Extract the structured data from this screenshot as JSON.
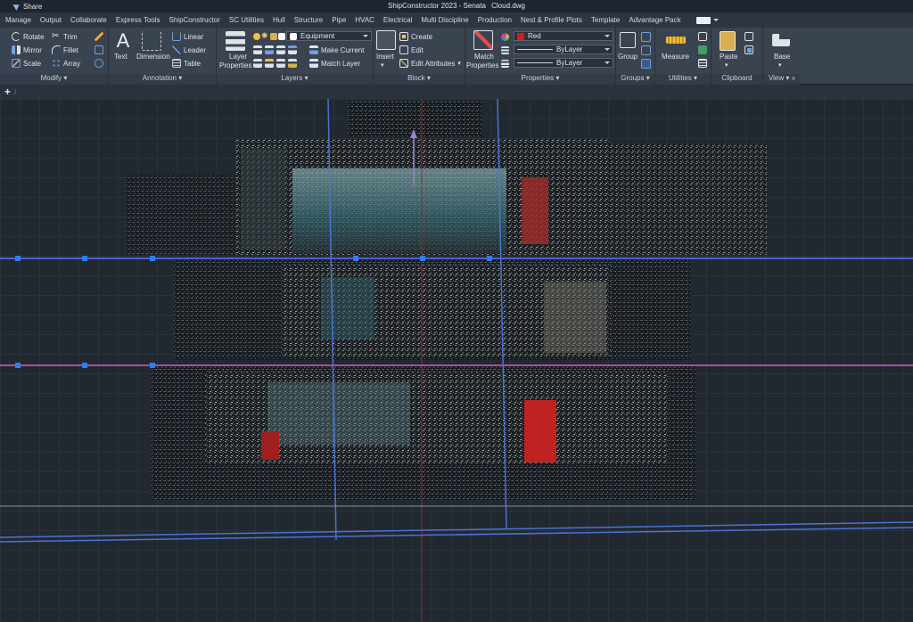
{
  "titlebar": {
    "share_label": "Share",
    "app_title": "ShipConstructor 2023 - Senata",
    "file_name": "Cloud.dwg"
  },
  "tabs": [
    "Manage",
    "Output",
    "Collaborate",
    "Express Tools",
    "ShipConstructor",
    "SC Utilities",
    "Hull",
    "Structure",
    "Pipe",
    "HVAC",
    "Electrical",
    "Multi Discipline",
    "Production",
    "Nest & Profile Plots",
    "Template",
    "Advantage Pack"
  ],
  "ribbon": {
    "modify": {
      "title": "Modify",
      "rotate": "Rotate",
      "trim": "Trim",
      "mirror": "Mirror",
      "fillet": "Fillet",
      "scale": "Scale",
      "array": "Array"
    },
    "annotation": {
      "title": "Annotation",
      "text": "Text",
      "dimension": "Dimension",
      "linear": "Linear",
      "leader": "Leader",
      "table": "Table"
    },
    "layers": {
      "title": "Layers",
      "layer_properties_1": "Layer",
      "layer_properties_2": "Properties",
      "current_layer": "Equipment",
      "make_current": "Make Current",
      "match_layer": "Match Layer"
    },
    "block": {
      "title": "Block",
      "insert": "Insert",
      "create": "Create",
      "edit": "Edit",
      "edit_attributes": "Edit Attributes"
    },
    "properties": {
      "title": "Properties",
      "match_1": "Match",
      "match_2": "Properties",
      "color": "Red",
      "linetype": "ByLayer",
      "lineweight": "ByLayer"
    },
    "groups": {
      "title": "Groups",
      "group": "Group"
    },
    "utilities": {
      "title": "Utilities",
      "measure": "Measure"
    },
    "clipboard": {
      "title": "Clipboard",
      "paste": "Paste"
    },
    "view": {
      "title": "View",
      "base": "Base"
    }
  },
  "colors": {
    "accent_blue": "#4a73d6",
    "red_swatch": "#e01818",
    "magenta_line": "#b04aa8",
    "grip_blue": "#2f7ff0"
  }
}
